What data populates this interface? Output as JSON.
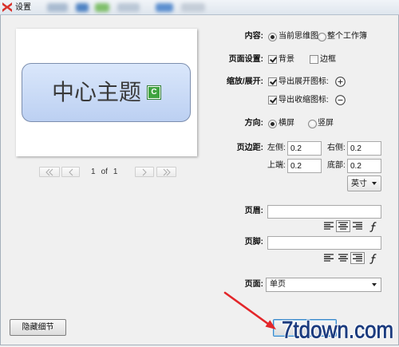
{
  "window": {
    "title": "设置",
    "logo_icon": "xmind-logo-icon"
  },
  "preview": {
    "topic_text": "中心主题",
    "marker_label": "C",
    "marker_icon": "marker-c-icon",
    "pager": {
      "first_icon": "first-page-icon",
      "prev_icon": "prev-page-icon",
      "next_icon": "next-page-icon",
      "last_icon": "last-page-icon",
      "current": "1",
      "of": "of",
      "total": "1"
    }
  },
  "settings": {
    "content": {
      "label": "内容:",
      "options": [
        {
          "label": "当前思维图",
          "selected": true
        },
        {
          "label": "整个工作簿",
          "selected": false
        }
      ]
    },
    "page_setup": {
      "label": "页面设置:",
      "options": [
        {
          "label": "背景",
          "checked": true
        },
        {
          "label": "边框",
          "checked": false
        }
      ]
    },
    "collapse_expand": {
      "label": "缩放/展开:",
      "options": [
        {
          "label": "导出展开图标:",
          "checked": true,
          "icon": "plus-circle-icon"
        },
        {
          "label": "导出收缩图标:",
          "checked": true,
          "icon": "minus-circle-icon"
        }
      ]
    },
    "orientation": {
      "label": "方向:",
      "options": [
        {
          "label": "横屏",
          "selected": true
        },
        {
          "label": "竖屏",
          "selected": false
        }
      ]
    },
    "margins": {
      "label": "页边距:",
      "left": {
        "label": "左侧:",
        "value": "0.2"
      },
      "right": {
        "label": "右侧:",
        "value": "0.2"
      },
      "top": {
        "label": "上端:",
        "value": "0.2"
      },
      "bottom": {
        "label": "底部:",
        "value": "0.2"
      },
      "unit": {
        "value": "英寸"
      }
    },
    "header": {
      "label": "页眉:",
      "value": "",
      "align_buttons": [
        {
          "icon": "align-left-icon",
          "selected": false
        },
        {
          "icon": "align-center-icon",
          "selected": true
        },
        {
          "icon": "align-right-icon",
          "selected": false
        },
        {
          "icon": "insert-field-icon",
          "selected": false
        }
      ]
    },
    "footer": {
      "label": "页脚:",
      "value": "",
      "align_buttons": [
        {
          "icon": "align-left-icon",
          "selected": false
        },
        {
          "icon": "align-center-icon",
          "selected": false
        },
        {
          "icon": "align-right-icon",
          "selected": true
        },
        {
          "icon": "insert-field-icon",
          "selected": false
        }
      ]
    },
    "pages": {
      "label": "页面:",
      "value": "单页"
    }
  },
  "buttons": {
    "hide_details": "隐藏细节"
  },
  "watermark": {
    "text": "7tdown.com"
  },
  "annotation": {
    "arrow_icon": "red-arrow-icon"
  },
  "colors": {
    "logo_red": "#d8312b",
    "topic_fill_top": "#dae7fb",
    "topic_fill_bottom": "#bcd0f2",
    "topic_border": "#7c8eae",
    "marker_green": "#3fa33f",
    "watermark": "#1b3b7e",
    "arrow_red": "#e3262a",
    "focus_blue": "#3a87c9"
  }
}
